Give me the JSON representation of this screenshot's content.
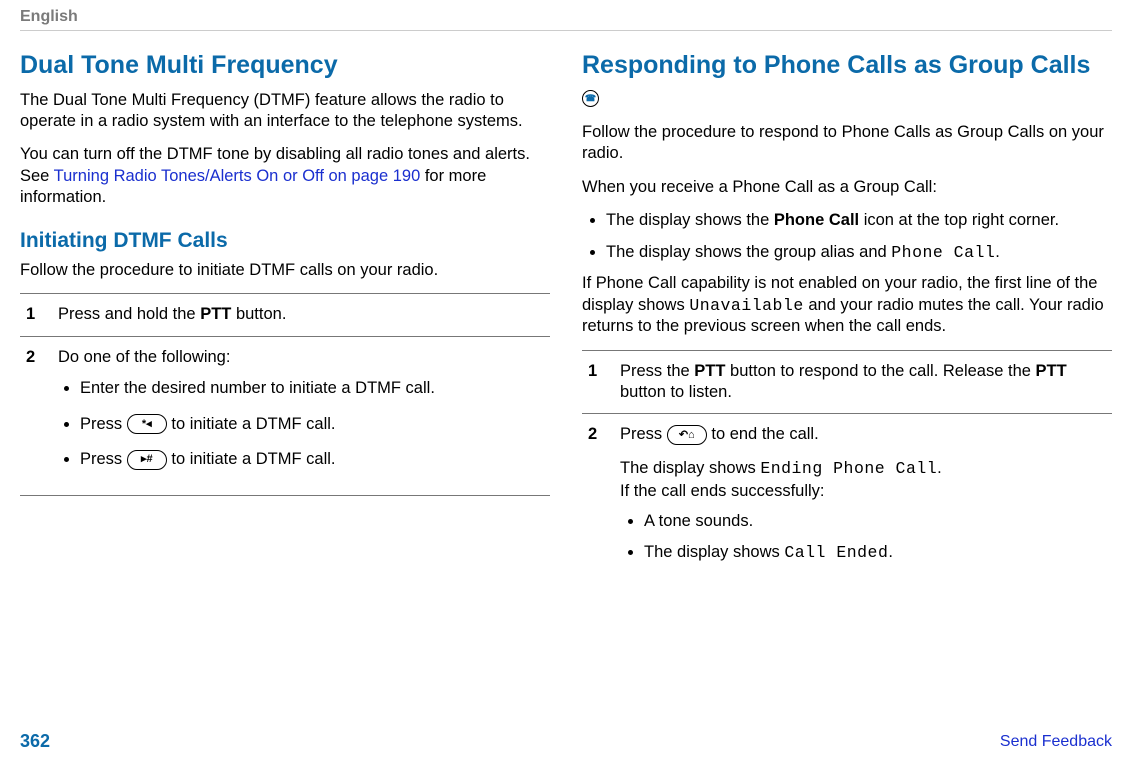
{
  "header": {
    "language": "English"
  },
  "left": {
    "heading1": "Dual Tone Multi Frequency",
    "p1": "The Dual Tone Multi Frequency (DTMF) feature allows the radio to operate in a radio system with an interface to the telephone systems.",
    "p2a": "You can turn off the DTMF tone by disabling all radio tones and alerts. See ",
    "p2_link": "Turning Radio Tones/Alerts On or Off on page 190",
    "p2b": " for more information.",
    "heading2": "Initiating DTMF Calls",
    "p3": "Follow the procedure to initiate DTMF calls on your radio.",
    "steps": [
      {
        "num": "1",
        "text_a": "Press and hold the ",
        "ptt": "PTT",
        "text_b": " button."
      },
      {
        "num": "2",
        "intro": "Do one of the following:",
        "bullets": [
          {
            "text": "Enter the desired number to initiate a DTMF call."
          },
          {
            "pre": "Press ",
            "icon": "star-left",
            "post": " to initiate a DTMF call."
          },
          {
            "pre": "Press ",
            "icon": "hash-right",
            "post": " to initiate a DTMF call."
          }
        ]
      }
    ]
  },
  "right": {
    "heading": "Responding to Phone Calls as Group Calls",
    "p1": "Follow the procedure to respond to Phone Calls as Group Calls on your radio.",
    "p2": "When you receive a Phone Call as a Group Call:",
    "bullets1": [
      {
        "a": "The display shows the ",
        "b": "Phone Call",
        "c": " icon at the top right corner."
      },
      {
        "a": "The display shows the group alias and ",
        "mono": "Phone Call",
        "c": "."
      }
    ],
    "p3a": "If Phone Call capability is not enabled on your radio, the first line of the display shows ",
    "p3_mono": "Unavailable",
    "p3b": " and your radio mutes the call. Your radio returns to the previous screen when the call ends.",
    "steps": [
      {
        "num": "1",
        "a": "Press the ",
        "ptt1": "PTT",
        "b": " button to respond to the call. Release the ",
        "ptt2": "PTT",
        "c": " button to listen."
      },
      {
        "num": "2",
        "l1a": "Press ",
        "l1b": " to end the call.",
        "l2a": "The display shows ",
        "l2_mono": "Ending Phone Call",
        "l2b": ".",
        "l3": "If the call ends successfully:",
        "bullets": [
          {
            "text": "A tone sounds."
          },
          {
            "a": "The display shows ",
            "mono": "Call Ended",
            "b": "."
          }
        ]
      }
    ]
  },
  "footer": {
    "page": "362",
    "feedback": "Send Feedback"
  }
}
